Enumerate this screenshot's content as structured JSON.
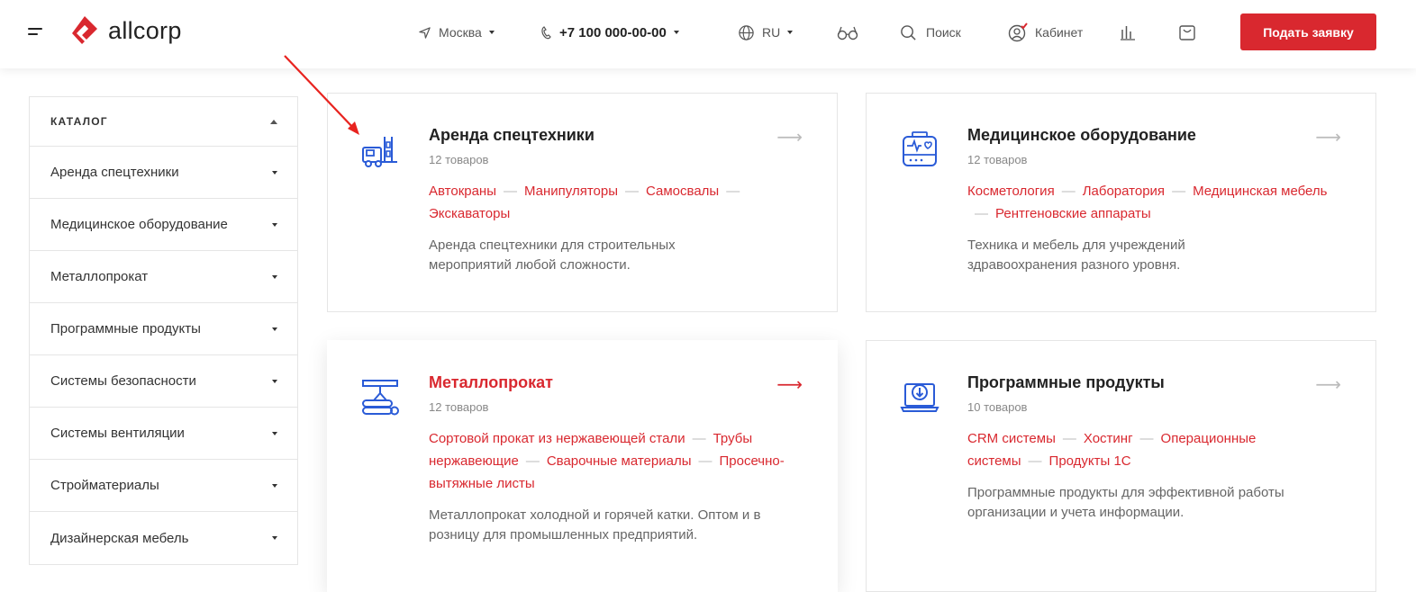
{
  "header": {
    "logo_text": "allcorp",
    "city": "Москва",
    "phone": "+7 100 000-00-00",
    "lang": "RU",
    "search_label": "Поиск",
    "cabinet_label": "Кабинет",
    "request_button": "Подать заявку",
    "brand_color": "#d9282f"
  },
  "sidebar": {
    "title": "КАТАЛОГ",
    "items": [
      {
        "label": "Аренда спецтехники"
      },
      {
        "label": "Медицинское оборудование"
      },
      {
        "label": "Металлопрокат"
      },
      {
        "label": "Программные продукты"
      },
      {
        "label": "Системы безопасности"
      },
      {
        "label": "Системы вентиляции"
      },
      {
        "label": "Стройматериалы"
      },
      {
        "label": "Дизайнерская мебель"
      }
    ]
  },
  "cards": [
    {
      "icon": "forklift-truck-icon",
      "title": "Аренда спецтехники",
      "count": "12 товаров",
      "links": [
        "Автокраны",
        "Манипуляторы",
        "Самосвалы",
        "Экскаваторы"
      ],
      "desc": "Аренда спецтехники для строительных мероприятий любой сложности."
    },
    {
      "icon": "medical-device-icon",
      "title": "Медицинское оборудование",
      "count": "12 товаров",
      "links": [
        "Косметология",
        "Лаборатория",
        "Медицинская мебель",
        "Рентгеновские аппараты"
      ],
      "desc": "Техника и мебель для учреждений здравоохранения разного уровня."
    },
    {
      "icon": "metal-pipes-icon",
      "title": "Металлопрокат",
      "count": "12 товаров",
      "links": [
        "Сортовой прокат из нержавеющей стали",
        "Трубы нержавеющие",
        "Сварочные материалы",
        "Просечно-вытяжные листы"
      ],
      "desc": "Металлопрокат холодной и горячей катки. Оптом и в розницу для промышленных предприятий."
    },
    {
      "icon": "laptop-download-icon",
      "title": "Программные продукты",
      "count": "10 товаров",
      "links": [
        "CRM системы",
        "Хостинг",
        "Операционные системы",
        "Продукты 1С"
      ],
      "desc": "Программные продукты для эффективной работы организации и учета информации."
    }
  ]
}
